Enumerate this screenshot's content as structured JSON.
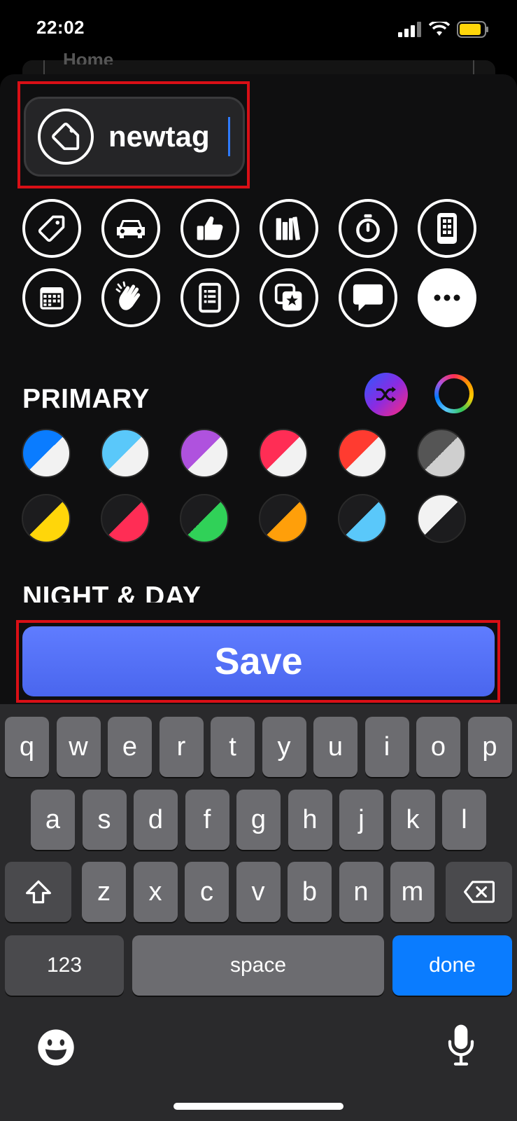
{
  "status": {
    "time": "22:02"
  },
  "background_sheet": {
    "title": "Home"
  },
  "tag": {
    "name": "newtag",
    "icon": "tag-icon"
  },
  "icons": [
    {
      "name": "tag-icon"
    },
    {
      "name": "car-icon"
    },
    {
      "name": "thumbs-up-icon"
    },
    {
      "name": "books-icon"
    },
    {
      "name": "timer-icon"
    },
    {
      "name": "phone-icon"
    },
    {
      "name": "calendar-icon"
    },
    {
      "name": "clapping-hands-icon"
    },
    {
      "name": "document-icon"
    },
    {
      "name": "star-photos-icon"
    },
    {
      "name": "chat-bubble-icon"
    },
    {
      "name": "more-icon"
    }
  ],
  "sections": {
    "primary": "PRIMARY",
    "night_day": "NIGHT & DAY"
  },
  "swatches_row1": [
    {
      "a": "#0a7cff",
      "b": "#f2f2f2"
    },
    {
      "a": "#5ac8fa",
      "b": "#f2f2f2"
    },
    {
      "a": "#af52de",
      "b": "#f2f2f2"
    },
    {
      "a": "#ff2d55",
      "b": "#f2f2f2"
    },
    {
      "a": "#ff3b30",
      "b": "#f2f2f2"
    },
    {
      "a": "#555555",
      "b": "#cfcfcf"
    }
  ],
  "swatches_row2": [
    {
      "a": "#1c1c1e",
      "b": "#ffd60a"
    },
    {
      "a": "#1c1c1e",
      "b": "#ff2d55"
    },
    {
      "a": "#1c1c1e",
      "b": "#30d158"
    },
    {
      "a": "#1c1c1e",
      "b": "#ff9f0a"
    },
    {
      "a": "#1c1c1e",
      "b": "#5ac8fa"
    },
    {
      "a": "#f2f2f2",
      "b": "#1c1c1e"
    }
  ],
  "save_label": "Save",
  "keyboard": {
    "row1": [
      "q",
      "w",
      "e",
      "r",
      "t",
      "y",
      "u",
      "i",
      "o",
      "p"
    ],
    "row2": [
      "a",
      "s",
      "d",
      "f",
      "g",
      "h",
      "j",
      "k",
      "l"
    ],
    "row3": [
      "z",
      "x",
      "c",
      "v",
      "b",
      "n",
      "m"
    ],
    "numbers": "123",
    "space": "space",
    "done": "done"
  },
  "colors": {
    "accent": "#5f7cff",
    "highlight": "#d90f16",
    "keyboard_done": "#0a7cff"
  }
}
